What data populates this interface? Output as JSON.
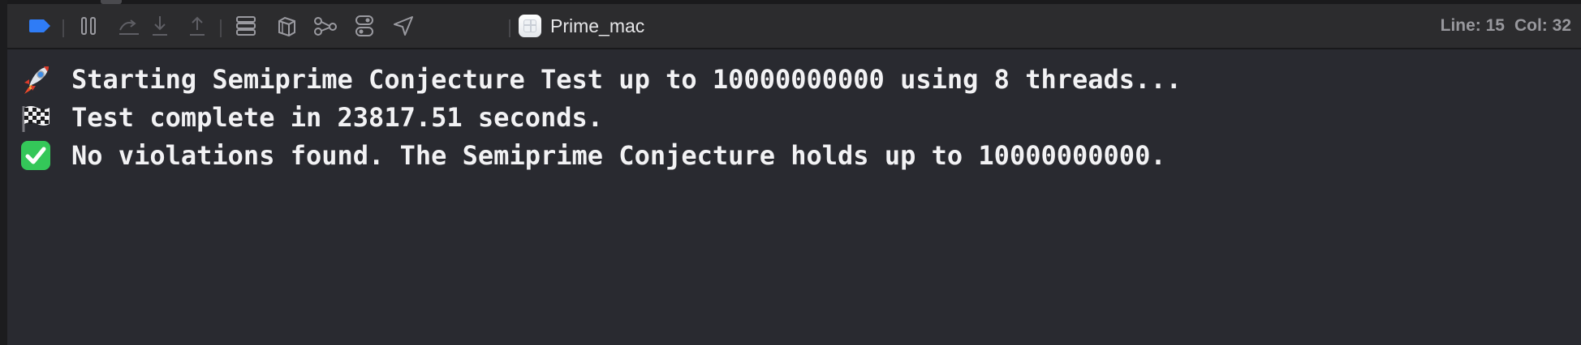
{
  "toolbar": {
    "icons": [
      "breakpoints-toggle-icon",
      "pause-icon",
      "step-over-icon",
      "step-into-icon",
      "step-out-icon",
      "view-hierarchy-icon",
      "memory-graph-icon",
      "environment-overrides-icon",
      "simulate-location-icon"
    ],
    "scheme_name": "Prime_mac",
    "line_label": "Line: 15",
    "col_label": "Col: 32"
  },
  "console": {
    "lines": [
      {
        "emoji": "rocket-emoji-icon",
        "text": "Starting Semiprime Conjecture Test up to 10000000000 using 8 threads..."
      },
      {
        "emoji": "checkered-flag-emoji-icon",
        "text": "Test complete in 23817.51 seconds."
      },
      {
        "emoji": "check-mark-emoji-icon",
        "text": "No violations found. The Semiprime Conjecture holds up to 10000000000."
      }
    ]
  },
  "colors": {
    "background": "#292a30",
    "toolbar": "#2c2c2e",
    "accent_blue": "#2f7cf6",
    "text": "#f2f2f4",
    "muted": "#98989d",
    "check_green": "#34c759"
  }
}
